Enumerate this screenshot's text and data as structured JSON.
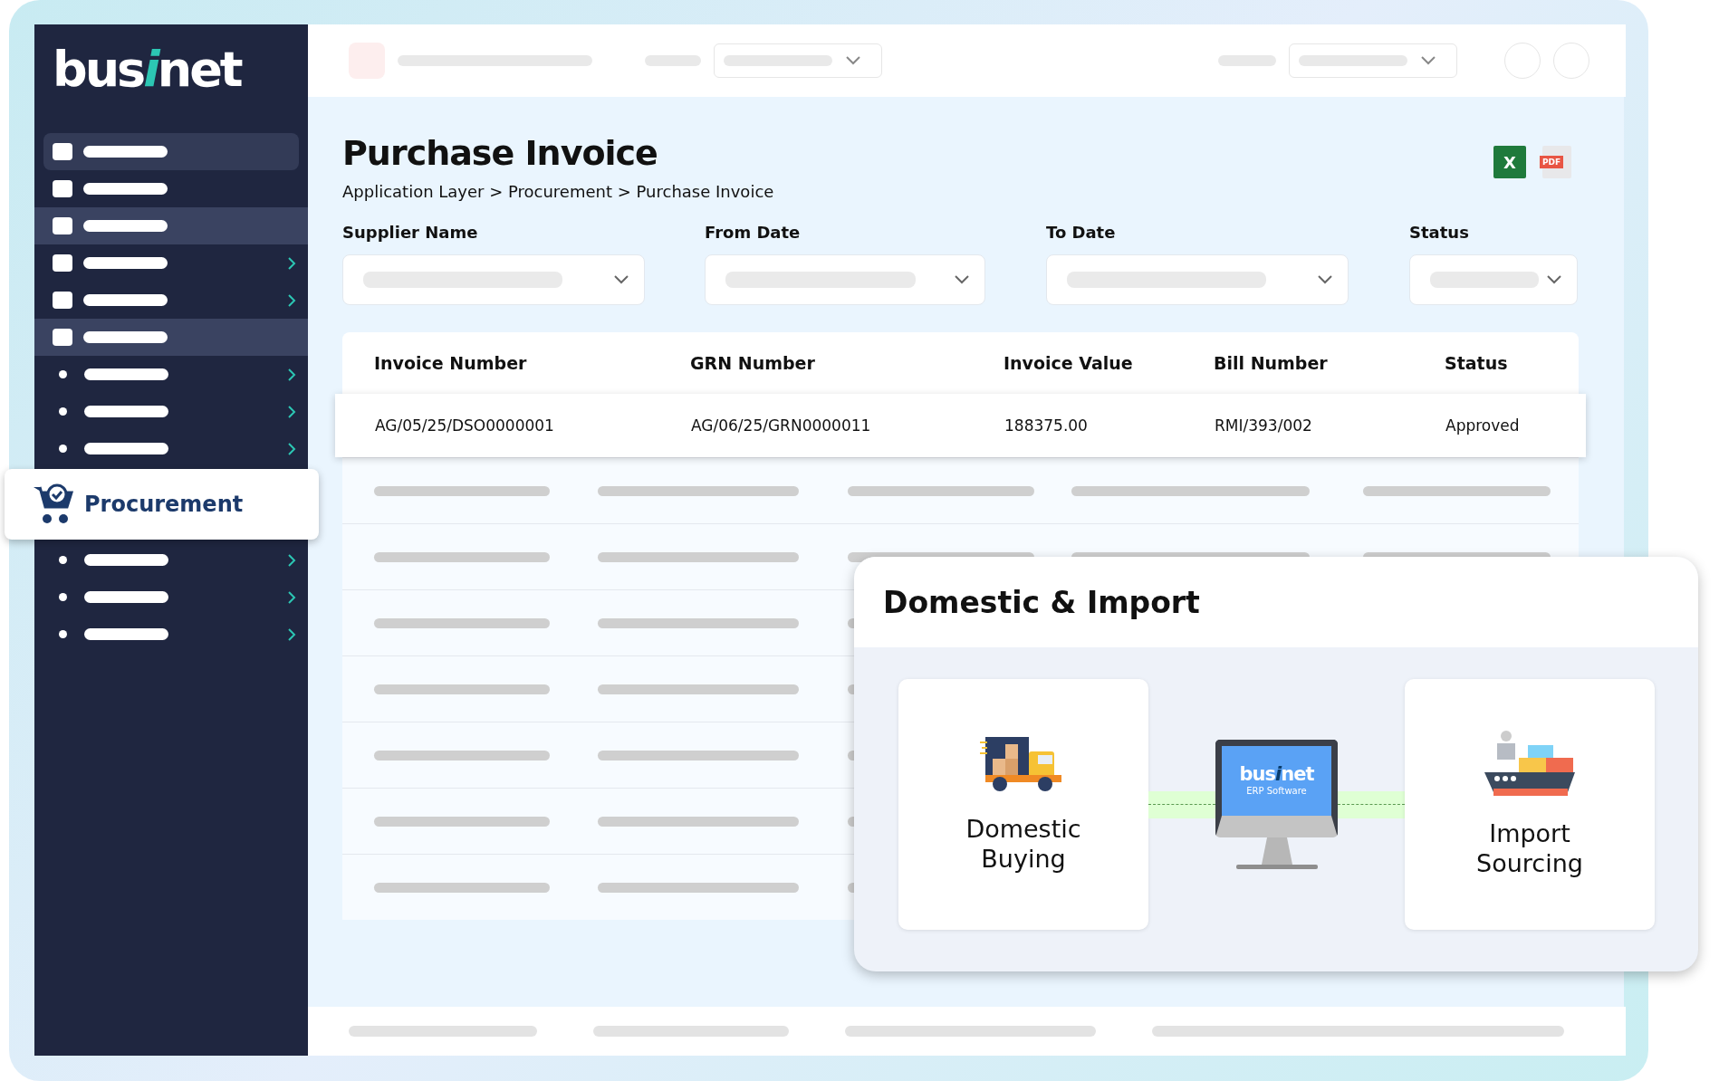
{
  "logo": {
    "before": "bus",
    "accent": "i",
    "after": "net"
  },
  "sidebar": {
    "items": [
      {
        "kind": "square",
        "selected": true,
        "highlighted": false,
        "chevron": false
      },
      {
        "kind": "square",
        "selected": false,
        "highlighted": false,
        "chevron": false
      },
      {
        "kind": "square",
        "selected": false,
        "highlighted": true,
        "chevron": false
      },
      {
        "kind": "square",
        "selected": false,
        "highlighted": false,
        "chevron": true
      },
      {
        "kind": "square",
        "selected": false,
        "highlighted": false,
        "chevron": true
      },
      {
        "kind": "square",
        "selected": false,
        "highlighted": true,
        "chevron": false
      },
      {
        "kind": "dot",
        "selected": false,
        "highlighted": false,
        "chevron": true
      },
      {
        "kind": "dot",
        "selected": false,
        "highlighted": false,
        "chevron": true
      },
      {
        "kind": "dot",
        "selected": false,
        "highlighted": false,
        "chevron": true
      },
      {
        "kind": "active",
        "label": "Procurement"
      },
      {
        "kind": "dot",
        "selected": false,
        "highlighted": false,
        "chevron": true
      },
      {
        "kind": "dot",
        "selected": false,
        "highlighted": false,
        "chevron": true
      },
      {
        "kind": "dot",
        "selected": false,
        "highlighted": false,
        "chevron": true
      }
    ]
  },
  "page": {
    "title": "Purchase Invoice",
    "breadcrumb": "Application Layer > Procurement > Purchase Invoice",
    "export": {
      "excel_mark": "X",
      "pdf_mark": "PDF"
    }
  },
  "filters": [
    {
      "label": "Supplier Name"
    },
    {
      "label": "From Date"
    },
    {
      "label": "To Date"
    },
    {
      "label": "Status"
    }
  ],
  "table": {
    "columns": [
      "Invoice Number",
      "GRN Number",
      "Invoice Value",
      "Bill Number",
      "Status"
    ],
    "rows": [
      [
        "AG/05/25/DSO0000001",
        "AG/06/25/GRN0000011",
        "188375.00",
        "RMI/393/002",
        "Approved"
      ]
    ]
  },
  "overlay": {
    "title": "Domestic & Import",
    "cards": [
      {
        "kind": "truck",
        "label": "Domestic Buying"
      },
      {
        "kind": "ship",
        "label": "Import Sourcing"
      }
    ],
    "monitor": {
      "before": "bus",
      "accent": "i",
      "after": "net",
      "caption": "ERP Software"
    }
  }
}
